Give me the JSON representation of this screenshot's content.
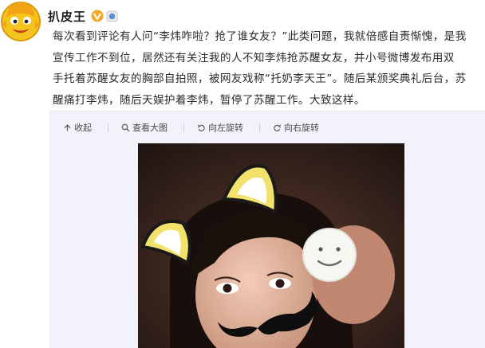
{
  "post": {
    "author": "扒皮王",
    "lines": [
      "每次看到评论有人问“李炜咋啦？抢了谁女友？”此类问题，我就倍感自责惭愧，是我",
      "宣传工作不到位，居然还有关注我的人不知李炜抢苏醒女友，并小号微博发布用双",
      "手托着苏醒女友的胸部自拍照，被网友戏称“托奶李天王”。随后某颁奖典礼后台，苏",
      "醒痛打李炜，随后天娱护着李炜，暂停了苏醒工作。大致这样。"
    ]
  },
  "toolbar": {
    "collapse": "收起",
    "view_large": "查看大图",
    "rotate_left": "向左旋转",
    "rotate_right": "向右旋转"
  },
  "colors": {
    "media_panel_bg": "#f3f2fb",
    "avatar_yellow": "#f6c51d",
    "verified_badge": "#f5a623"
  },
  "icons": [
    "verified-icon",
    "badge-icon",
    "collapse-icon",
    "magnifier-icon",
    "rotate-left-icon",
    "rotate-right-icon"
  ]
}
